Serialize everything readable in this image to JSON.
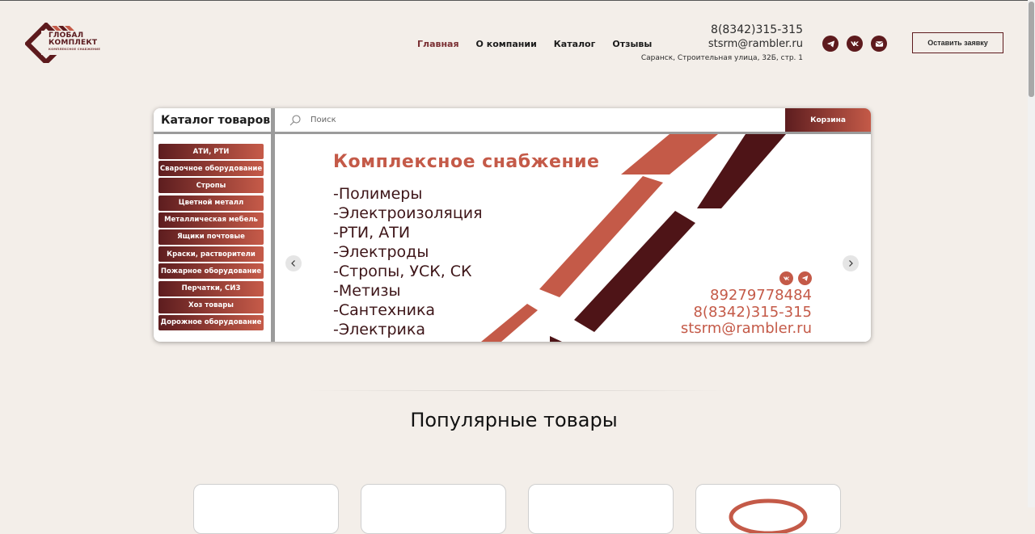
{
  "logo": {
    "line1": "ГЛОБАЛ",
    "line2": "КОМПЛЕКТ",
    "tagline": "КОМПЛЕКСНОЕ СНАБЖЕНИЕ"
  },
  "nav": {
    "items": [
      {
        "label": "Главная",
        "active": true
      },
      {
        "label": "О компании"
      },
      {
        "label": "Каталог"
      },
      {
        "label": "Отзывы"
      }
    ]
  },
  "contacts": {
    "phone": "8(8342)315-315",
    "email": "stsrm@rambler.ru",
    "address": "Саранск, Строительная улица, 32Б, стр. 1"
  },
  "social": [
    "telegram-icon",
    "vk-icon",
    "mail-icon"
  ],
  "cta_label": "Оставить заявку",
  "catalog": {
    "title": "Каталог товаров",
    "search_placeholder": "Поиск",
    "basket_label": "Корзина",
    "categories": [
      "АТИ, РТИ",
      "Сварочное оборудование",
      "Стропы",
      "Цветной металл",
      "Металлическая мебель",
      "Ящики почтовые",
      "Краски, растворители",
      "Пожарное оборудование",
      "Перчатки, СИЗ",
      "Хоз товары",
      "Дорожное оборудование"
    ]
  },
  "banner": {
    "heading": "Комплексное снабжение",
    "list": [
      "-Полимеры",
      "-Электроизоляция",
      "-РТИ, АТИ",
      "-Электроды",
      "-Стропы, УСК, СК",
      "-Метизы",
      "-Сантехника",
      "-Электрика"
    ],
    "phone1": "89279778484",
    "phone2": "8(8342)315-315",
    "email": "stsrm@rambler.ru"
  },
  "popular_title": "Популярные товары",
  "colors": {
    "accent": "#5d1a1d",
    "accent_light": "#c45a48",
    "background": "#f3eee9"
  }
}
